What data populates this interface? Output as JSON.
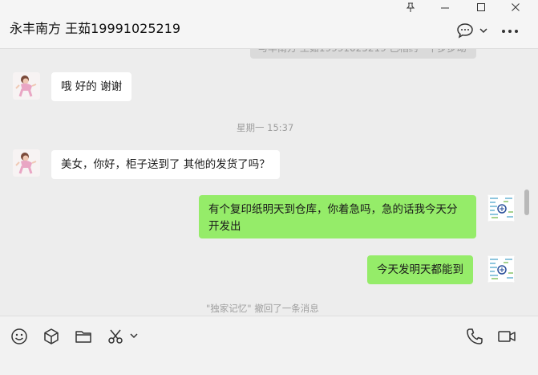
{
  "header": {
    "title": "永丰南方 王茹19991025219",
    "window_controls": [
      "pin-icon",
      "minimize-icon",
      "maximize-icon",
      "close-icon"
    ],
    "actions": [
      "chat-bubble-icon",
      "chevron-down-icon",
      "more-icon"
    ]
  },
  "chat": {
    "cutoff_text": "与丰南方 王茹19991025219 已相约一下步步动",
    "messages": [
      {
        "side": "left",
        "text": "哦 好的  谢谢"
      },
      {
        "side": "system",
        "text": "星期一 15:37"
      },
      {
        "side": "left",
        "text": "美女，你好，柜子送到了   其他的发货了吗？"
      },
      {
        "side": "right",
        "line1": "有个复印纸明天到仓库，你着急吗，急的话我今天分",
        "line2": "开发出"
      },
      {
        "side": "right",
        "text": "今天发明天都能到"
      },
      {
        "side": "system",
        "text": "\"独家记忆\" 撤回了一条消息"
      }
    ]
  },
  "toolbar": {
    "left_tools": [
      "emoji-icon",
      "sticker-box-icon",
      "folder-icon",
      "scissors-icon",
      "chevron-down-icon"
    ],
    "right_tools": [
      "phone-icon",
      "video-icon"
    ]
  },
  "colors": {
    "background": "#ededed",
    "bubble_left": "#ffffff",
    "bubble_right": "#95ec69",
    "system_text": "#9e9e9e"
  }
}
